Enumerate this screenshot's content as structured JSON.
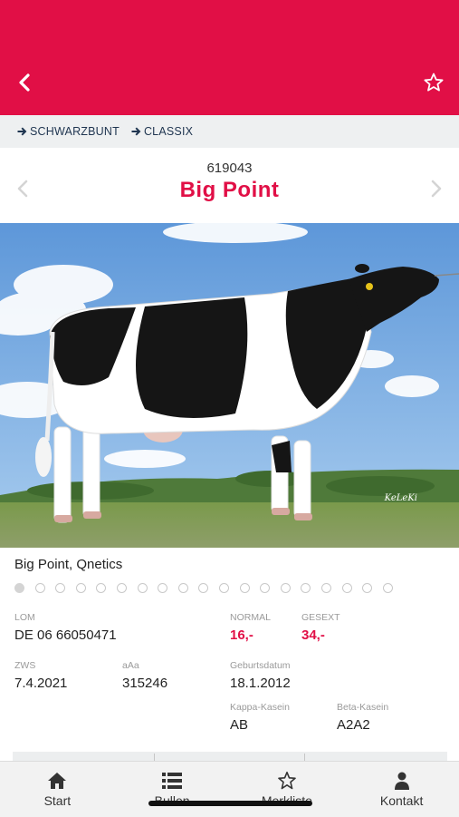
{
  "colors": {
    "brand": "#e10f46",
    "breadcrumb_bg": "#eef0f1",
    "text_dark": "#1f3550"
  },
  "header": {
    "back_icon": "chevron-left-icon",
    "favorite_icon": "star-outline-icon"
  },
  "breadcrumb": [
    {
      "label": "SCHWARZBUNT",
      "icon": "arrow-right-icon"
    },
    {
      "label": "CLASSIX",
      "icon": "arrow-right-icon"
    }
  ],
  "bull": {
    "id": "619043",
    "name": "Big Point"
  },
  "photo": {
    "watermark": "KeLeKi"
  },
  "caption": "Big Point, Qnetics",
  "gallery": {
    "count": 19,
    "active_index": 0
  },
  "fields": {
    "lom": {
      "label": "LOM",
      "value": "DE 06 66050471"
    },
    "normal": {
      "label": "NORMAL",
      "value": "16,-"
    },
    "gesext": {
      "label": "GESEXT",
      "value": "34,-"
    },
    "zws": {
      "label": "ZWS",
      "value": "7.4.2021"
    },
    "aaa": {
      "label": "aAa",
      "value": "315246"
    },
    "geburtsdatum": {
      "label": "Geburtsdatum",
      "value": "18.1.2012"
    },
    "kappa": {
      "label": "Kappa-Kasein",
      "value": "AB"
    },
    "beta": {
      "label": "Beta-Kasein",
      "value": "A2A2"
    }
  },
  "tabs": [
    {
      "label": "Start",
      "icon": "home-icon"
    },
    {
      "label": "Bullen",
      "icon": "list-icon"
    },
    {
      "label": "Merkliste",
      "icon": "star-outline-icon"
    },
    {
      "label": "Kontakt",
      "icon": "person-icon"
    }
  ]
}
